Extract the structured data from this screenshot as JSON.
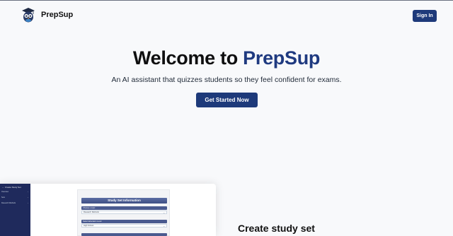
{
  "header": {
    "brand": "PrepSup",
    "signin_label": "Sign In"
  },
  "hero": {
    "title_prefix": "Welcome to ",
    "title_accent": "PrepSup",
    "tagline": "An AI assistant that quizzes students so they feel confident for exams.",
    "cta_label": "Get Started Now"
  },
  "preview": {
    "sidebar_title": "← Create Study Set",
    "sidebar_items": [
      "Overview",
      "Sets",
      "Research Methods"
    ],
    "card_title": "Study Set Information",
    "field1_label": "Choose a topic",
    "field1_value": "Research Methods",
    "field2_label": "Select Education Level",
    "field2_value": "High School"
  },
  "feature": {
    "title": "Create study set"
  },
  "colors": {
    "accent": "#1f3a80",
    "button": "#1e3a7a",
    "sidebar": "#1f2a5c",
    "background": "#f8f9fb"
  }
}
